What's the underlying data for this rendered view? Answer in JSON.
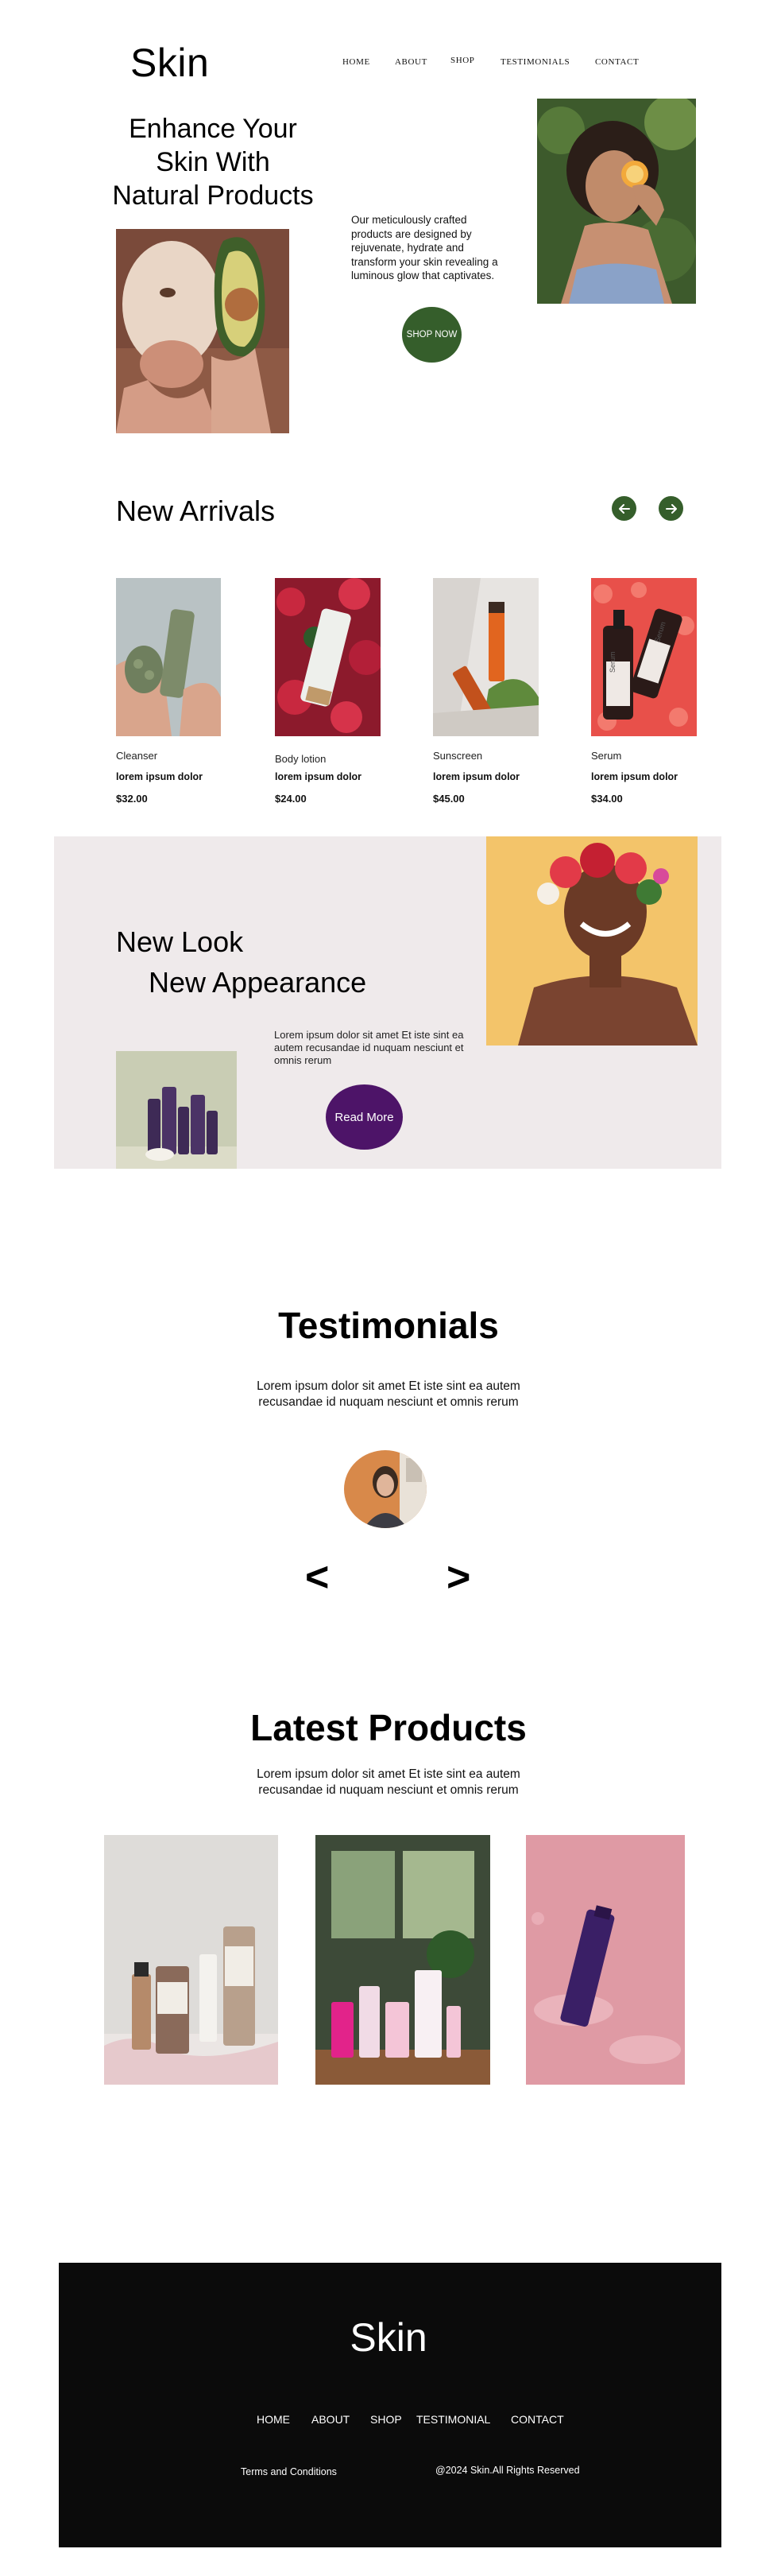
{
  "header": {
    "brand": "Skin",
    "nav": [
      "HOME",
      "ABOUT",
      "SHOP",
      "TESTIMONIALS",
      "CONTACT"
    ]
  },
  "hero": {
    "title_lines": [
      "Enhance Your",
      "Skin With",
      "Natural Products"
    ],
    "description": "Our meticulously crafted products are designed by rejuvenate, hydrate and transform your skin revealing a luminous glow that captivates.",
    "cta": "SHOP NOW"
  },
  "arrivals": {
    "title": "New Arrivals",
    "products": [
      {
        "category": "Cleanser",
        "name": "lorem ipsum dolor",
        "price": "$32.00"
      },
      {
        "category": "Body lotion",
        "name": "lorem ipsum dolor",
        "price": "$24.00"
      },
      {
        "category": "Sunscreen",
        "name": "lorem ipsum dolor",
        "price": "$45.00"
      },
      {
        "category": "Serum",
        "name": "lorem ipsum dolor",
        "price": "$34.00"
      }
    ],
    "bottle_label": "Serum"
  },
  "banner": {
    "line1": "New Look",
    "line2": "New Appearance",
    "text": "Lorem ipsum dolor sit amet Et iste sint ea autem recusandae id nuquam nesciunt et omnis rerum",
    "cta": "Read More"
  },
  "testimonials": {
    "title": "Testimonials",
    "text_lines": [
      "Lorem ipsum dolor sit amet Et iste sint ea autem",
      "recusandae id nuquam nesciunt et omnis rerum"
    ],
    "prev": "<",
    "next": ">"
  },
  "latest": {
    "title": "Latest Products",
    "text_lines": [
      "Lorem ipsum dolor sit amet Et iste sint ea autem",
      "recusandae id nuquam nesciunt et omnis rerum"
    ]
  },
  "footer": {
    "brand": "Skin",
    "nav": [
      "HOME",
      "ABOUT",
      "SHOP",
      "TESTIMONIAL",
      "CONTACT"
    ],
    "terms": "Terms and Conditions",
    "copyright": "@2024 Skin.All Rights Reserved"
  },
  "colors": {
    "accent_green": "#355e2b",
    "accent_purple": "#4d1468",
    "banner_bg": "#efeaeb",
    "footer_bg": "#0b0b0b"
  },
  "icons": [
    "arrow-left-icon",
    "arrow-right-icon"
  ]
}
